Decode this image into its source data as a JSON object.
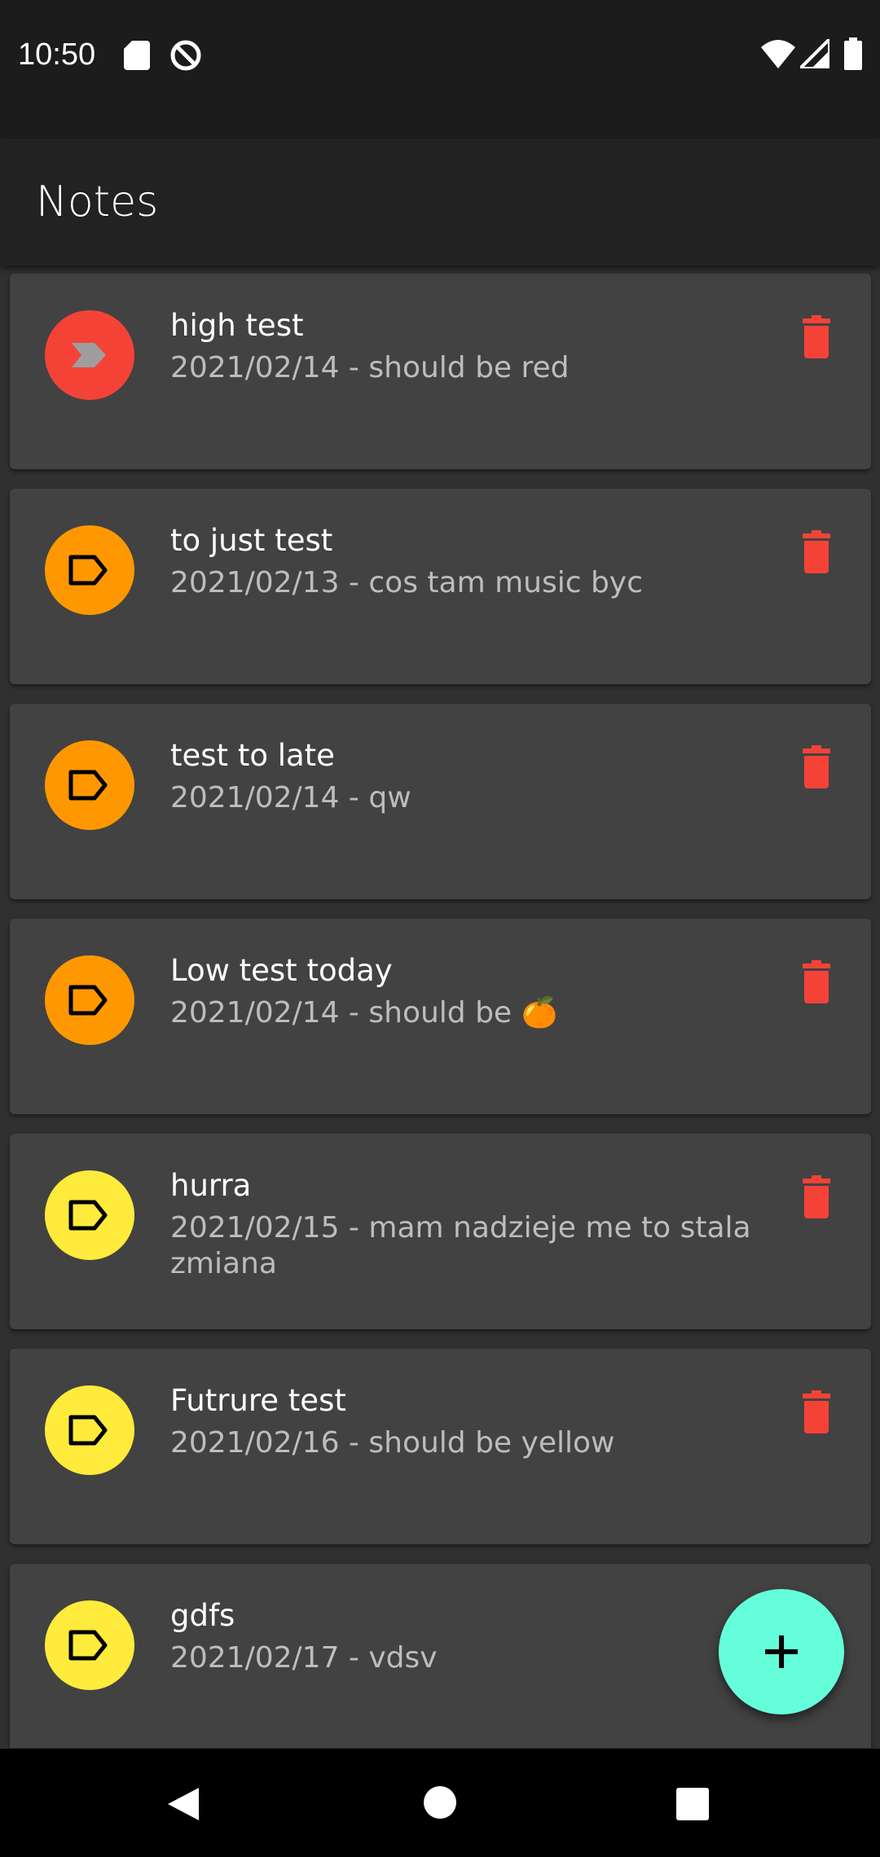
{
  "status_bar": {
    "time": "10:50",
    "icons": [
      "sd-card-icon",
      "at-sign-icon",
      "wifi-icon",
      "signal-icon",
      "battery-icon"
    ]
  },
  "app_bar": {
    "title": "Notes"
  },
  "notes": [
    {
      "title": "high test",
      "subtitle": "2021/02/14 - should be red",
      "priority_color": "#f44336",
      "icon": "chevron-label-icon"
    },
    {
      "title": "to just test",
      "subtitle": "2021/02/13 - cos tam music byc",
      "priority_color": "#ff9800",
      "icon": "label-outline-icon"
    },
    {
      "title": "test to late",
      "subtitle": "2021/02/14 - qw",
      "priority_color": "#ff9800",
      "icon": "label-outline-icon"
    },
    {
      "title": "Low test today",
      "subtitle": "2021/02/14 - should be 🍊",
      "priority_color": "#ff9800",
      "icon": "label-outline-icon"
    },
    {
      "title": "hurra",
      "subtitle": "2021/02/15 - mam nadzieje me to stala zmiana",
      "priority_color": "#ffeb3b",
      "icon": "label-outline-icon"
    },
    {
      "title": "Futrure test",
      "subtitle": "2021/02/16 - should be yellow",
      "priority_color": "#ffeb3b",
      "icon": "label-outline-icon"
    },
    {
      "title": "gdfs",
      "subtitle": "2021/02/17 - vdsv",
      "priority_color": "#ffeb3b",
      "icon": "label-outline-icon"
    }
  ],
  "colors": {
    "delete": "#f44336",
    "fab": "#64ffda",
    "card": "#424242",
    "background": "#303030"
  },
  "fab": {
    "icon": "plus-icon"
  }
}
